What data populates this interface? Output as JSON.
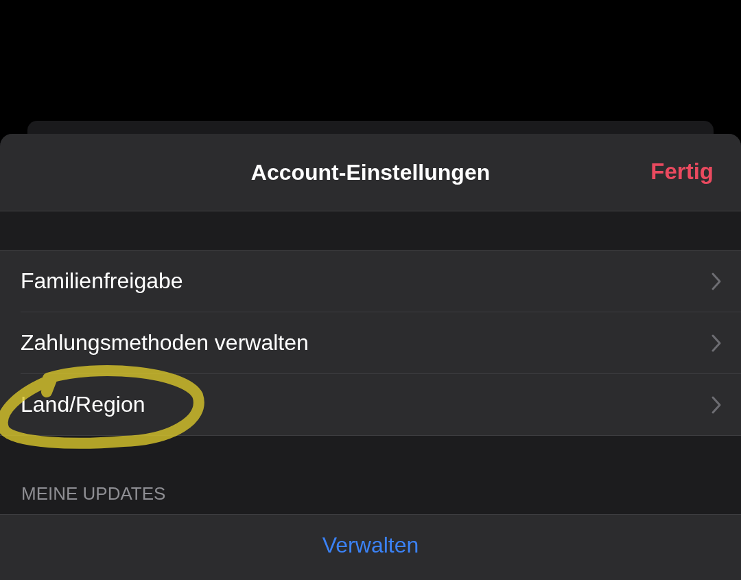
{
  "header": {
    "title": "Account-Einstellungen",
    "done_button": "Fertig"
  },
  "rows": [
    {
      "label": "Familienfreigabe",
      "highlighted": false
    },
    {
      "label": "Zahlungsmethoden verwalten",
      "highlighted": false
    },
    {
      "label": "Land/Region",
      "highlighted": true
    }
  ],
  "section": {
    "header": "MEINE UPDATES",
    "action": "Verwalten"
  }
}
